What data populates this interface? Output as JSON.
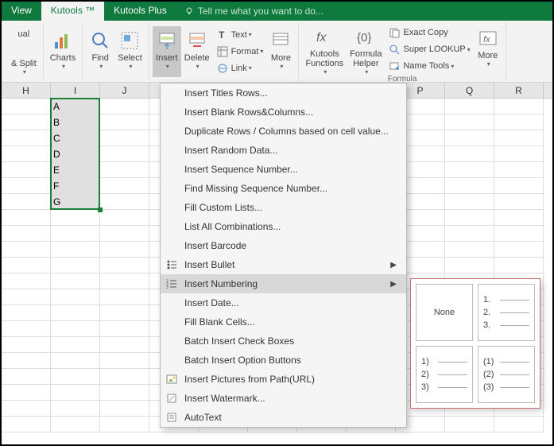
{
  "tabs": {
    "view": "View",
    "kutools": "Kutools ™",
    "kutools_plus": "Kutools Plus"
  },
  "tell_me": "Tell me what you want to do...",
  "ribbon": {
    "ual": "ual",
    "split": "& Split",
    "charts": "Charts",
    "find": "Find",
    "select": "Select",
    "insert": "Insert",
    "delete": "Delete",
    "text": "Text",
    "format": "Format",
    "link": "Link",
    "more1": "More",
    "kutools_functions": "Kutools\nFunctions",
    "formula_helper": "Formula\nHelper",
    "exact_copy": "Exact Copy",
    "super_lookup": "Super LOOKUP",
    "name_tools": "Name Tools",
    "more2": "More",
    "formula_label": "Formula"
  },
  "columns": [
    "H",
    "I",
    "J",
    "",
    "",
    "",
    "",
    "",
    "P",
    "Q",
    "R"
  ],
  "cells": [
    "A",
    "B",
    "C",
    "D",
    "E",
    "F",
    "G"
  ],
  "menu": {
    "items": [
      "Insert Titles Rows...",
      "Insert Blank Rows&Columns...",
      "Duplicate Rows / Columns based on cell value...",
      "Insert Random Data...",
      "Insert Sequence Number...",
      "Find Missing Sequence Number...",
      "Fill Custom Lists...",
      "List All Combinations...",
      "Insert Barcode",
      "Insert Bullet",
      "Insert Numbering",
      "Insert Date...",
      "Fill Blank Cells...",
      "Batch Insert Check Boxes",
      "Batch Insert Option Buttons",
      "Insert Pictures from Path(URL)",
      "Insert Watermark...",
      "AutoText"
    ]
  },
  "numbering": {
    "none": "None",
    "opt2": [
      "1.",
      "2.",
      "3."
    ],
    "opt3": [
      "1)",
      "2)",
      "3)"
    ],
    "opt4": [
      "(1)",
      "(2)",
      "(3)"
    ]
  }
}
